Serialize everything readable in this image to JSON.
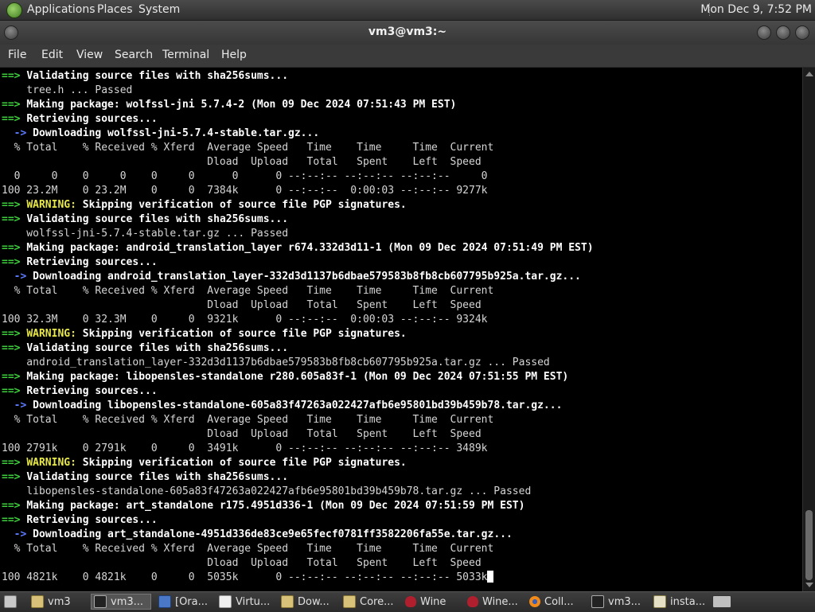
{
  "top_panel": {
    "menus": [
      "Applications",
      "Places",
      "System"
    ],
    "clock": "Mon Dec 9, 7:52 PM"
  },
  "window": {
    "title": "vm3@vm3:~"
  },
  "menubar": {
    "items": [
      "File",
      "Edit",
      "View",
      "Search",
      "Terminal",
      "Help"
    ]
  },
  "terminal": {
    "lines": [
      [
        {
          "t": "==> ",
          "c": "g"
        },
        {
          "t": "Validating source files with sha256sums...",
          "c": "w"
        }
      ],
      [
        {
          "t": "    tree.h ... Passed",
          "c": "n"
        }
      ],
      [
        {
          "t": "==> ",
          "c": "g"
        },
        {
          "t": "Making package: wolfssl-jni 5.7.4-2 (Mon 09 Dec 2024 07:51:43 PM EST)",
          "c": "w"
        }
      ],
      [
        {
          "t": "==> ",
          "c": "g"
        },
        {
          "t": "Retrieving sources...",
          "c": "w"
        }
      ],
      [
        {
          "t": "  -> ",
          "c": "b"
        },
        {
          "t": "Downloading wolfssl-jni-5.7.4-stable.tar.gz...",
          "c": "w"
        }
      ],
      [
        {
          "t": "  % Total    % Received % Xferd  Average Speed   Time    Time     Time  Current",
          "c": "n"
        }
      ],
      [
        {
          "t": "                                 Dload  Upload   Total   Spent    Left  Speed",
          "c": "n"
        }
      ],
      [
        {
          "t": "  0     0    0     0    0     0      0      0 --:--:-- --:--:-- --:--:--     0",
          "c": "n"
        }
      ],
      [
        {
          "t": "100 23.2M    0 23.2M    0     0  7384k      0 --:--:--  0:00:03 --:--:-- 9277k",
          "c": "n"
        }
      ],
      [
        {
          "t": "==> ",
          "c": "g"
        },
        {
          "t": "WARNING:",
          "c": "y"
        },
        {
          "t": " Skipping verification of source file PGP signatures.",
          "c": "w"
        }
      ],
      [
        {
          "t": "==> ",
          "c": "g"
        },
        {
          "t": "Validating source files with sha256sums...",
          "c": "w"
        }
      ],
      [
        {
          "t": "    wolfssl-jni-5.7.4-stable.tar.gz ... Passed",
          "c": "n"
        }
      ],
      [
        {
          "t": "==> ",
          "c": "g"
        },
        {
          "t": "Making package: android_translation_layer r674.332d3d11-1 (Mon 09 Dec 2024 07:51:49 PM EST)",
          "c": "w"
        }
      ],
      [
        {
          "t": "==> ",
          "c": "g"
        },
        {
          "t": "Retrieving sources...",
          "c": "w"
        }
      ],
      [
        {
          "t": "  -> ",
          "c": "b"
        },
        {
          "t": "Downloading android_translation_layer-332d3d1137b6dbae579583b8fb8cb607795b925a.tar.gz...",
          "c": "w"
        }
      ],
      [
        {
          "t": "  % Total    % Received % Xferd  Average Speed   Time    Time     Time  Current",
          "c": "n"
        }
      ],
      [
        {
          "t": "                                 Dload  Upload   Total   Spent    Left  Speed",
          "c": "n"
        }
      ],
      [
        {
          "t": "100 32.3M    0 32.3M    0     0  9321k      0 --:--:--  0:00:03 --:--:-- 9324k",
          "c": "n"
        }
      ],
      [
        {
          "t": "==> ",
          "c": "g"
        },
        {
          "t": "WARNING:",
          "c": "y"
        },
        {
          "t": " Skipping verification of source file PGP signatures.",
          "c": "w"
        }
      ],
      [
        {
          "t": "==> ",
          "c": "g"
        },
        {
          "t": "Validating source files with sha256sums...",
          "c": "w"
        }
      ],
      [
        {
          "t": "    android_translation_layer-332d3d1137b6dbae579583b8fb8cb607795b925a.tar.gz ... Passed",
          "c": "n"
        }
      ],
      [
        {
          "t": "==> ",
          "c": "g"
        },
        {
          "t": "Making package: libopensles-standalone r280.605a83f-1 (Mon 09 Dec 2024 07:51:55 PM EST)",
          "c": "w"
        }
      ],
      [
        {
          "t": "==> ",
          "c": "g"
        },
        {
          "t": "Retrieving sources...",
          "c": "w"
        }
      ],
      [
        {
          "t": "  -> ",
          "c": "b"
        },
        {
          "t": "Downloading libopensles-standalone-605a83f47263a022427afb6e95801bd39b459b78.tar.gz...",
          "c": "w"
        }
      ],
      [
        {
          "t": "  % Total    % Received % Xferd  Average Speed   Time    Time     Time  Current",
          "c": "n"
        }
      ],
      [
        {
          "t": "                                 Dload  Upload   Total   Spent    Left  Speed",
          "c": "n"
        }
      ],
      [
        {
          "t": "100 2791k    0 2791k    0     0  3491k      0 --:--:-- --:--:-- --:--:-- 3489k",
          "c": "n"
        }
      ],
      [
        {
          "t": "==> ",
          "c": "g"
        },
        {
          "t": "WARNING:",
          "c": "y"
        },
        {
          "t": " Skipping verification of source file PGP signatures.",
          "c": "w"
        }
      ],
      [
        {
          "t": "==> ",
          "c": "g"
        },
        {
          "t": "Validating source files with sha256sums...",
          "c": "w"
        }
      ],
      [
        {
          "t": "    libopensles-standalone-605a83f47263a022427afb6e95801bd39b459b78.tar.gz ... Passed",
          "c": "n"
        }
      ],
      [
        {
          "t": "==> ",
          "c": "g"
        },
        {
          "t": "Making package: art_standalone r175.4951d336-1 (Mon 09 Dec 2024 07:51:59 PM EST)",
          "c": "w"
        }
      ],
      [
        {
          "t": "==> ",
          "c": "g"
        },
        {
          "t": "Retrieving sources...",
          "c": "w"
        }
      ],
      [
        {
          "t": "  -> ",
          "c": "b"
        },
        {
          "t": "Downloading art_standalone-4951d336de83ce9e65fecf0781ff3582206fa55e.tar.gz...",
          "c": "w"
        }
      ],
      [
        {
          "t": "  % Total    % Received % Xferd  Average Speed   Time    Time     Time  Current",
          "c": "n"
        }
      ],
      [
        {
          "t": "                                 Dload  Upload   Total   Spent    Left  Speed",
          "c": "n"
        }
      ],
      [
        {
          "t": "100 4821k    0 4821k    0     0  5035k      0 --:--:-- --:--:-- --:--:-- 5033k",
          "c": "n"
        }
      ]
    ]
  },
  "taskbar": {
    "items": [
      {
        "label": "",
        "icon": "show-desktop-icon"
      },
      {
        "label": "vm3",
        "icon": "folder-icon"
      },
      {
        "label": "vm3...",
        "icon": "terminal-icon",
        "active": true
      },
      {
        "label": "[Ora...",
        "icon": "virtualbox-icon"
      },
      {
        "label": "Virtu...",
        "icon": "document-icon"
      },
      {
        "label": "Dow...",
        "icon": "folder-icon"
      },
      {
        "label": "Core...",
        "icon": "folder-icon"
      },
      {
        "label": "Wine",
        "icon": "wine-icon"
      },
      {
        "label": "Wine...",
        "icon": "wine-icon"
      },
      {
        "label": "Coll...",
        "icon": "firefox-icon"
      },
      {
        "label": "vm3...",
        "icon": "terminal-icon"
      },
      {
        "label": "insta...",
        "icon": "text-editor-icon"
      },
      {
        "label": "",
        "icon": "workspace-switcher-icon"
      }
    ]
  },
  "colors": {
    "prompt_green": "#3dd03d",
    "arrow_blue": "#5c7bff",
    "warning_yellow": "#e8e84a",
    "terminal_bg": "#000000"
  }
}
